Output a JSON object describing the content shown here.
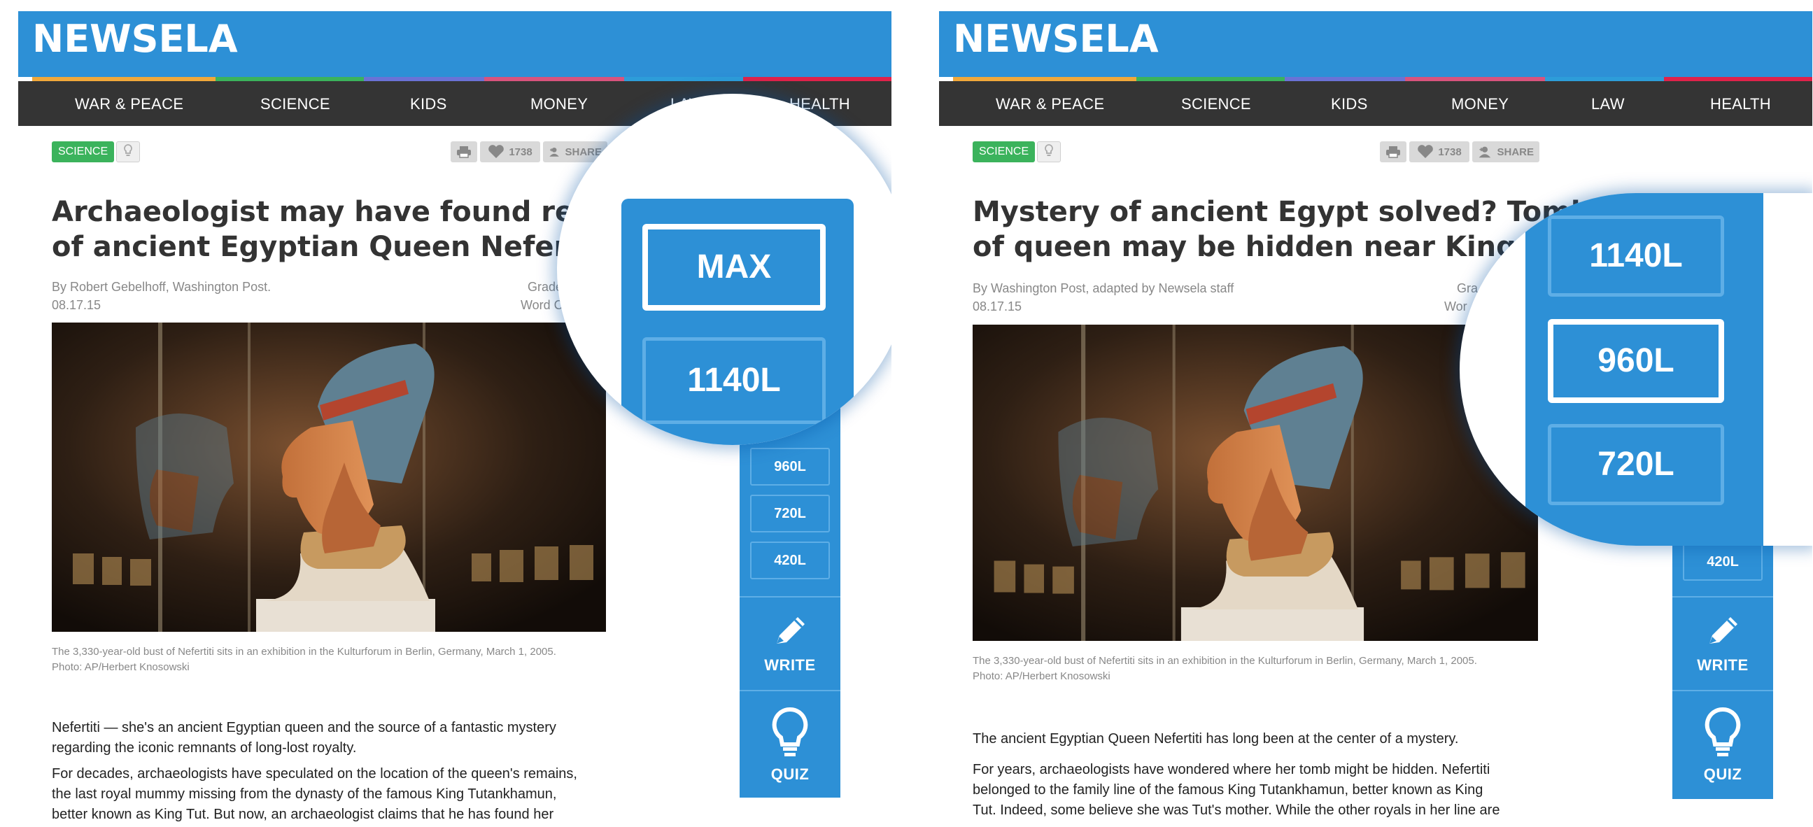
{
  "brand": {
    "logo": "NEWSELA",
    "bar_colors": [
      "#f1a83a",
      "#3bb35c",
      "#6b72d6",
      "#d9537d",
      "#2d9dd9",
      "#e0224a"
    ]
  },
  "nav": [
    "WAR & PEACE",
    "SCIENCE",
    "KIDS",
    "MONEY",
    "LAW",
    "HEALTH"
  ],
  "left": {
    "tag": "SCIENCE",
    "likes": "1738",
    "share": "SHARE",
    "title_line1": "Archaeologist may have found remai",
    "title_line2": "of ancient Egyptian Queen Nefertiti",
    "author": "By Robert Gebelhoff, Washington Post.",
    "date": "08.17.15",
    "grade_partial": "Grade",
    "wordcount_partial": "Word Co",
    "caption_line1": "The 3,330-year-old bust of Nefertiti sits in an exhibition in the Kulturforum in Berlin, Germany, March 1, 2005.",
    "caption_line2": "Photo: AP/Herbert Knosowski",
    "para1_line1": "Nefertiti — she's an ancient Egyptian queen and the source of a fantastic mystery",
    "para1_line2": "regarding the iconic remnants of long-lost royalty.",
    "para2_line1": "For decades, archaeologists have speculated on the location of the queen's remains,",
    "para2_line2": "the last royal mummy missing from the dynasty of the famous King Tutankhamun,",
    "para2_line3": "better known as King Tut. But now, an archaeologist claims that he has found her",
    "levels": [
      "960L",
      "720L",
      "420L"
    ],
    "zoom_levels": [
      "MAX",
      "1140L"
    ],
    "zoom_selected": "MAX"
  },
  "right": {
    "tag": "SCIENCE",
    "likes": "1738",
    "share": "SHARE",
    "title_line1": "Mystery of ancient Egypt solved? Tomb",
    "title_line2": "of queen may be hidden near King Tut",
    "author": "By Washington Post, adapted by Newsela staff",
    "date": "08.17.15",
    "grade_partial": "Gra",
    "wordcount_partial": "Wor",
    "caption_line1": "The 3,330-year-old bust of Nefertiti sits in an exhibition in the Kulturforum in Berlin, Germany, March 1, 2005.",
    "caption_line2": "Photo: AP/Herbert Knosowski",
    "para1_line1": "The ancient Egyptian Queen Nefertiti has long been at the center of a mystery.",
    "para2_line1": "For years, archaeologists have wondered where her tomb might be hidden. Nefertiti",
    "para2_line2": "belonged to the family line of the famous King Tutankhamun, better known as King",
    "para2_line3": "Tut. Indeed, some believe she was Tut's mother. While the other royals in her line are",
    "levels": [
      "420L"
    ],
    "zoom_levels": [
      "1140L",
      "960L",
      "720L"
    ],
    "zoom_selected": "960L"
  },
  "actions": {
    "write": "WRITE",
    "quiz": "QUIZ"
  },
  "icons": [
    "print-icon",
    "heart-icon",
    "add-user-icon",
    "lightbulb-icon",
    "pencil-icon"
  ]
}
